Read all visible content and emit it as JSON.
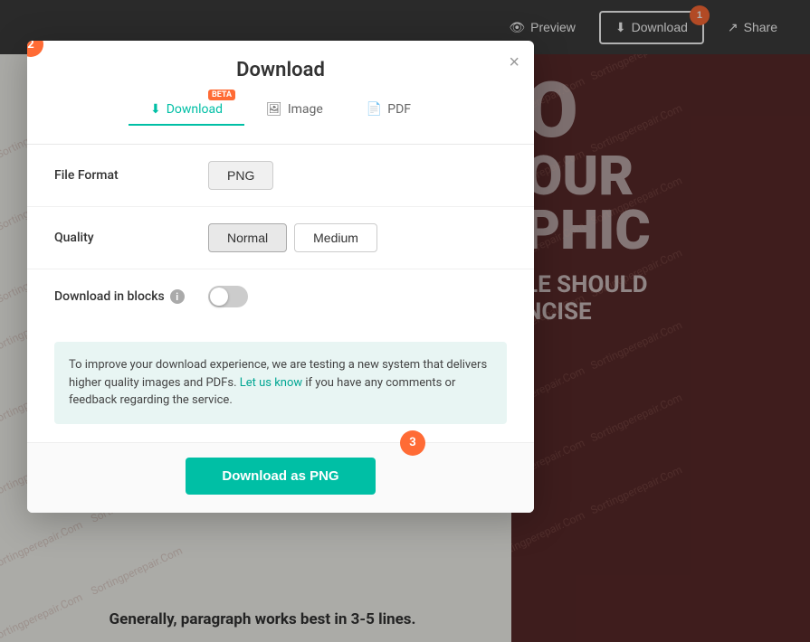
{
  "toolbar": {
    "preview_label": "Preview",
    "download_label": "Download",
    "share_label": "Share",
    "download_step_badge": "1"
  },
  "dialog": {
    "title": "Download",
    "close_label": "×",
    "tabs": [
      {
        "id": "download",
        "label": "Download",
        "active": true,
        "beta": true
      },
      {
        "id": "image",
        "label": "Image",
        "active": false,
        "beta": false
      },
      {
        "id": "pdf",
        "label": "PDF",
        "active": false,
        "beta": false
      }
    ],
    "file_format_label": "File Format",
    "file_format_value": "PNG",
    "quality_label": "Quality",
    "quality_options": [
      {
        "label": "Normal",
        "active": true
      },
      {
        "label": "Medium",
        "active": false
      }
    ],
    "download_in_blocks_label": "Download in blocks",
    "info_text_prefix": "To improve your download experience, we are testing a new system that delivers higher quality images and PDFs. ",
    "info_link_text": "Let us know",
    "info_text_suffix": " if you have any comments or feedback regarding the service.",
    "download_button_label": "Download as PNG",
    "step_badge_dialog": "2",
    "step_badge_button": "3"
  },
  "canvas": {
    "big_letters": "O",
    "line1": "OUR",
    "line2": "PHIC",
    "slogan1": "LE SHOULD",
    "slogan2": "NCISE",
    "bottom_text": "Generally, paragraph works best in 3-5 lines."
  },
  "watermark": {
    "text": "Sortingperepair.Com"
  }
}
